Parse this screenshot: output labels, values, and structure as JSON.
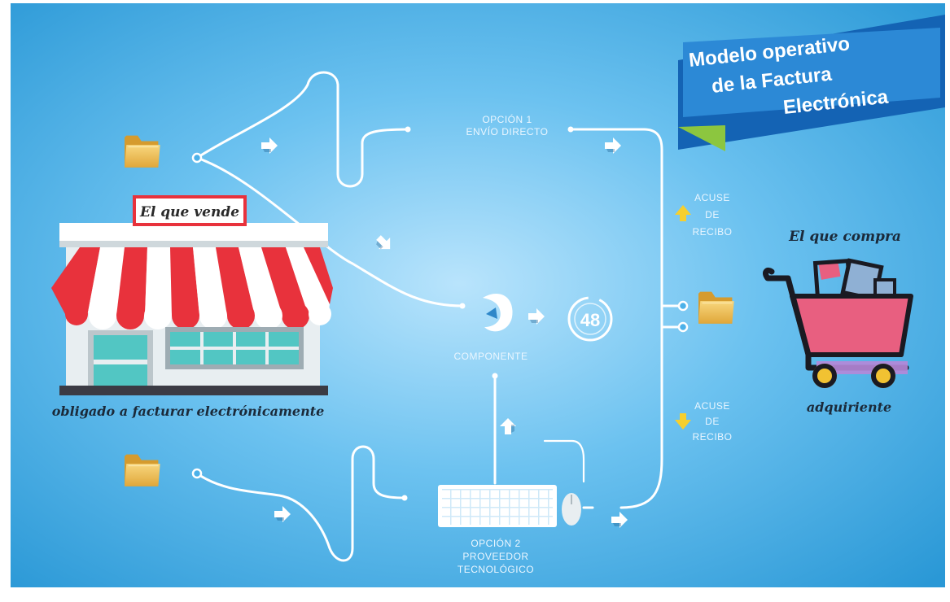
{
  "title": {
    "line1": "Modelo operativo",
    "line2": "de la Factura",
    "line3": "Electrónica"
  },
  "seller": {
    "sign": "El que vende",
    "caption": "obligado a facturar electrónicamente"
  },
  "buyer": {
    "label": "El que compra",
    "caption": "adquiriente"
  },
  "option1": {
    "line1": "OPCIÓN 1",
    "line2": "ENVÍO DIRECTO"
  },
  "option2": {
    "line1": "OPCIÓN 2",
    "line2": "PROVEEDOR",
    "line3": "TECNOLÓGICO"
  },
  "component": {
    "label": "COMPONENTE",
    "badge": "48"
  },
  "ack_top": {
    "line1": "ACUSE",
    "line2": "DE",
    "line3": "RECIBO"
  },
  "ack_bottom": {
    "line1": "ACUSE",
    "line2": "DE",
    "line3": "RECIBO"
  },
  "colors": {
    "background_center": "#b6e2fb",
    "background_edge": "#2a9ad8",
    "banner": "#1565b8",
    "banner_accent": "#8cc63f",
    "awning_red": "#e8323c",
    "cart_pink": "#e8506c",
    "folder_yellow": "#f2c14e"
  }
}
